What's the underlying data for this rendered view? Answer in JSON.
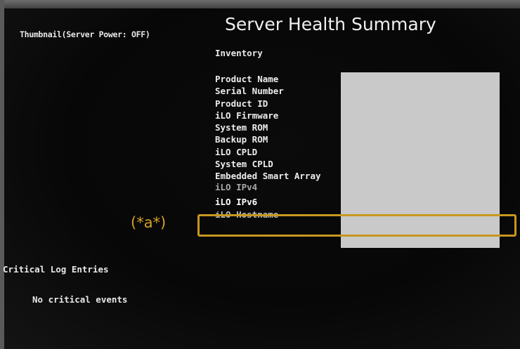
{
  "thumbnail_label": "Thumbnail(Server Power: OFF)",
  "title": "Server Health Summary",
  "inventory": {
    "heading": "Inventory",
    "fields": [
      "Product Name",
      "Serial Number",
      "Product ID",
      "iLO Firmware",
      "System ROM",
      "Backup ROM",
      "iLO CPLD",
      "System CPLD",
      "Embedded Smart Array",
      "iLO IPv4",
      "iLO IPv6",
      "iLO Hostname"
    ]
  },
  "callout": {
    "label": "(*a*)"
  },
  "critical_log": {
    "heading": "Critical Log Entries",
    "empty_text": "No critical events"
  },
  "colors": {
    "screen_bg": "#0b0b0b",
    "text": "#e8e8e8",
    "redaction": "#c9c9c9",
    "callout": "#c8971f"
  }
}
